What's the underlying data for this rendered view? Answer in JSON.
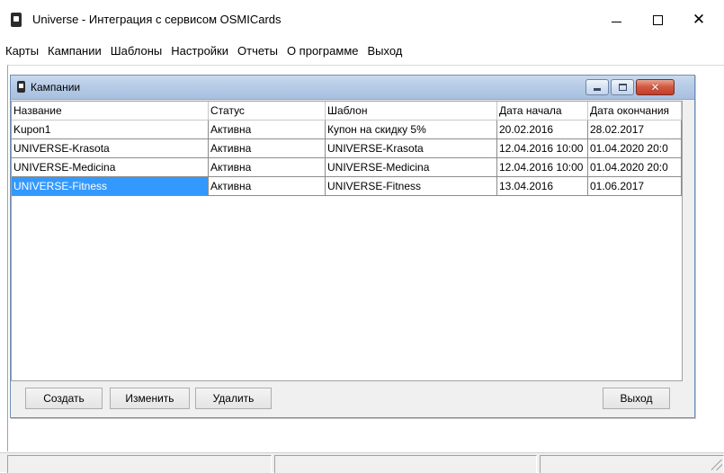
{
  "window": {
    "title": "Universe - Интеграция с сервисом OSMICards",
    "minimize_glyph": "",
    "close_glyph": "✕"
  },
  "menu": {
    "items": [
      "Карты",
      "Кампании",
      "Шаблоны",
      "Настройки",
      "Отчеты",
      "О программе",
      "Выход"
    ]
  },
  "child_window": {
    "title": "Кампании",
    "close_glyph": "✕"
  },
  "grid": {
    "columns": [
      "Название",
      "Статус",
      "Шаблон",
      "Дата начала",
      "Дата окончания"
    ],
    "rows": [
      [
        "Kupon1",
        "Активна",
        "Купон на скидку 5%",
        "20.02.2016",
        "28.02.2017"
      ],
      [
        "UNIVERSE-Krasota",
        "Активна",
        "UNIVERSE-Krasota",
        "12.04.2016 10:00",
        "01.04.2020 20:0"
      ],
      [
        "UNIVERSE-Medicina",
        "Активна",
        "UNIVERSE-Medicina",
        "12.04.2016 10:00",
        "01.04.2020 20:0"
      ],
      [
        "UNIVERSE-Fitness",
        "Активна",
        "UNIVERSE-Fitness",
        "13.04.2016",
        "01.06.2017"
      ]
    ],
    "selected_row": 3
  },
  "buttons": {
    "create": "Создать",
    "edit": "Изменить",
    "delete": "Удалить",
    "exit": "Выход"
  },
  "colors": {
    "selection": "#3399ff",
    "child_titlebar": "#b5cae6",
    "close_button": "#c33d26"
  }
}
